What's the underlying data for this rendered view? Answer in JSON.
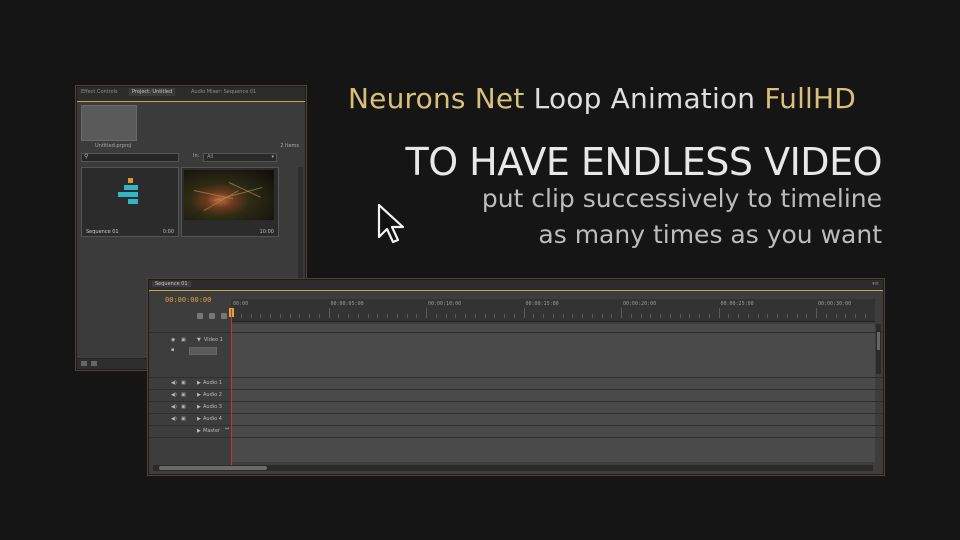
{
  "headline": {
    "part1": "Neurons Net",
    "part2": "Loop Animation",
    "part3": "FullHD",
    "main": "TO HAVE ENDLESS VIDEO",
    "sub1": "put clip successively to timeline",
    "sub2": "as many times as you want",
    "gold_color": "#d9c07a"
  },
  "project_panel": {
    "tabs": [
      "Effect Controls",
      "Project: Untitled",
      "Audio Mixer: Sequence 01"
    ],
    "active_tab": "Project: Untitled",
    "project_file": "Untitled.prproj",
    "item_count": "2 Items",
    "in_label": "In:",
    "in_value": "All",
    "bins": [
      {
        "label": "Sequence 01",
        "duration": "0:00"
      },
      {
        "label": "",
        "duration": "10:00"
      }
    ]
  },
  "timeline": {
    "tab": "Sequence 01",
    "timecode": "00:00:00:00",
    "ruler_ticks": [
      "00:00",
      "00:00:05:00",
      "00:00:10:00",
      "00:00:15:00",
      "00:00:20:00",
      "00:00:25:00",
      "00:00:30:00"
    ],
    "video_tracks": [
      {
        "name": "Video 1"
      }
    ],
    "audio_tracks": [
      {
        "name": "Audio 1"
      },
      {
        "name": "Audio 2"
      },
      {
        "name": "Audio 3"
      },
      {
        "name": "Audio 4"
      }
    ],
    "master": "Master",
    "accent_color": "#e0a43a"
  },
  "icons": [
    "mouse-cursor-icon",
    "search-icon",
    "eye-icon",
    "lock-icon",
    "speaker-icon",
    "triangle-expand-icon"
  ]
}
